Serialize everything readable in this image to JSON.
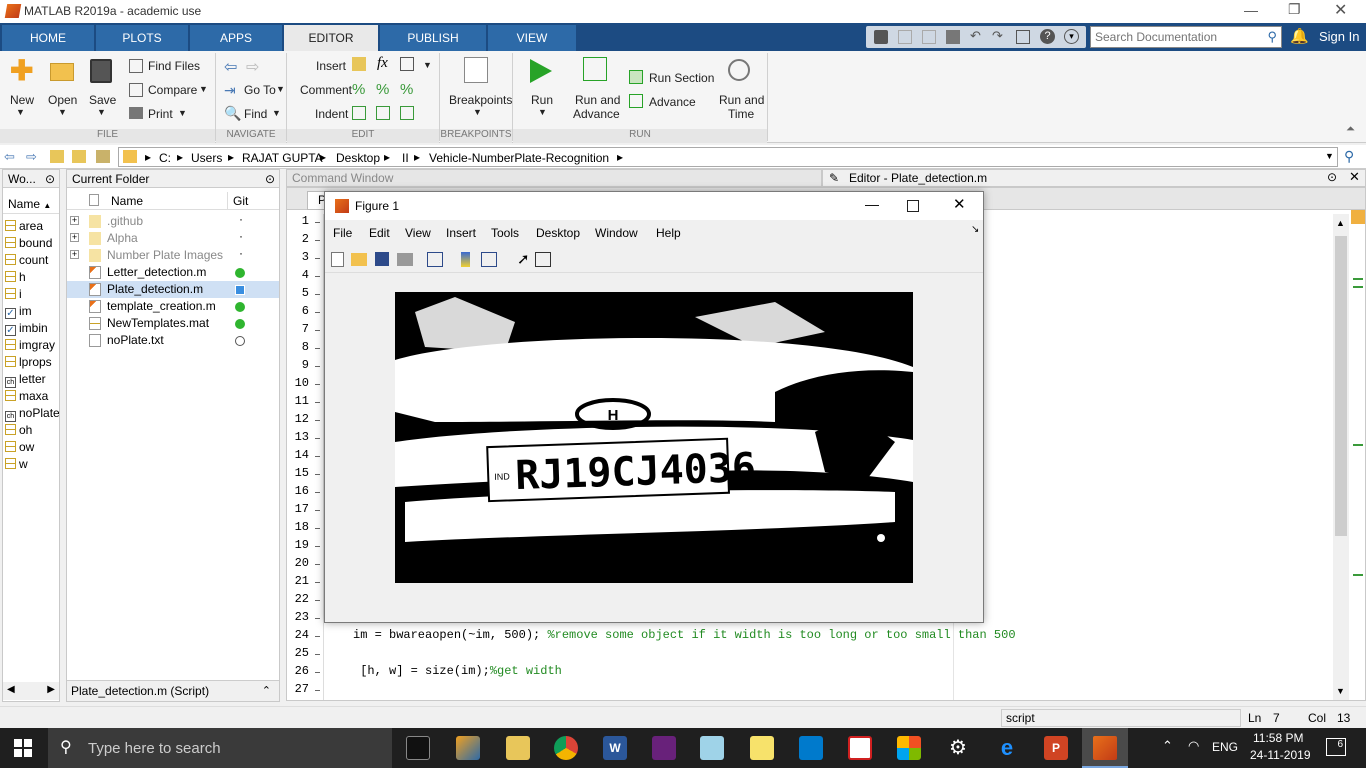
{
  "app": {
    "title": "MATLAB R2019a - academic use"
  },
  "tabs": [
    "HOME",
    "PLOTS",
    "APPS",
    "EDITOR",
    "PUBLISH",
    "VIEW"
  ],
  "search": {
    "placeholder": "Search Documentation"
  },
  "signin": "Sign In",
  "ribbon": {
    "new": "New",
    "open": "Open",
    "save": "Save",
    "find_files": "Find Files",
    "compare": "Compare",
    "print": "Print",
    "goto": "Go To",
    "find": "Find",
    "insert": "Insert",
    "comment": "Comment",
    "indent": "Indent",
    "fx": "fx",
    "breakpoints": "Breakpoints",
    "run": "Run",
    "run_advance_1": "Run and",
    "run_advance_2": "Advance",
    "run_section": "Run Section",
    "advance": "Advance",
    "run_time_1": "Run and",
    "run_time_2": "Time",
    "groups": {
      "file": "FILE",
      "navigate": "NAVIGATE",
      "edit": "EDIT",
      "breakpoints": "BREAKPOINTS",
      "run": "RUN"
    }
  },
  "path": [
    "C:",
    "Users",
    "RAJAT GUPTA",
    "Desktop",
    "II",
    "Vehicle-NumberPlate-Recognition"
  ],
  "workspace": {
    "title": "Wo...",
    "col_name": "Name",
    "vars": [
      "area",
      "bound",
      "count",
      "h",
      "i",
      "im",
      "imbin",
      "imgray",
      "lprops",
      "letter",
      "maxa",
      "noPlate",
      "oh",
      "ow",
      "w"
    ]
  },
  "folder": {
    "title": "Current Folder",
    "col_name": "Name",
    "col_git": "Git",
    "items": [
      {
        "name": ".github",
        "git": "·"
      },
      {
        "name": "Alpha",
        "git": "·"
      },
      {
        "name": "Number Plate Images",
        "git": "·"
      },
      {
        "name": "Letter_detection.m",
        "git": "green"
      },
      {
        "name": "Plate_detection.m",
        "git": "blue"
      },
      {
        "name": "template_creation.m",
        "git": "green"
      },
      {
        "name": "NewTemplates.mat",
        "git": "green"
      },
      {
        "name": "noPlate.txt",
        "git": "circle"
      }
    ],
    "status": "Plate_detection.m  (Script)"
  },
  "command_window": {
    "title": "Command Window"
  },
  "editor": {
    "title": "Editor - Plate_detection.m",
    "tab": "P",
    "line_numbers": [
      "1",
      "2",
      "3",
      "4",
      "5",
      "6",
      "7",
      "8",
      "9",
      "10",
      "11",
      "12",
      "13",
      "14",
      "15",
      "16",
      "17",
      "18",
      "19",
      "20",
      "21",
      "22",
      "23",
      "24",
      "25",
      "26",
      "27"
    ],
    "line24_code": "im = bwareaopen(~im, 500); ",
    "line24_comment": "%remove some object if it width is too long or too small than 500",
    "line26_code": " [h, w] = size(im);",
    "line26_comment": "%get width"
  },
  "figure": {
    "title": "Figure 1",
    "menu": [
      "File",
      "Edit",
      "View",
      "Insert",
      "Tools",
      "Desktop",
      "Window",
      "Help"
    ],
    "plate_text": "RJ19CJ4036",
    "plate_prefix": "IND"
  },
  "statusbar": {
    "mode": "script",
    "ln_label": "Ln",
    "ln": "7",
    "col_label": "Col",
    "col": "13"
  },
  "taskbar": {
    "search_placeholder": "Type here to search",
    "lang": "ENG",
    "time": "11:58 PM",
    "date": "24-11-2019",
    "notif": "6"
  },
  "colors": {
    "tabbar": "#1c4b82",
    "accent": "#2d6aa8",
    "comment": "#228b22",
    "taskbar": "#1f1f1f"
  }
}
